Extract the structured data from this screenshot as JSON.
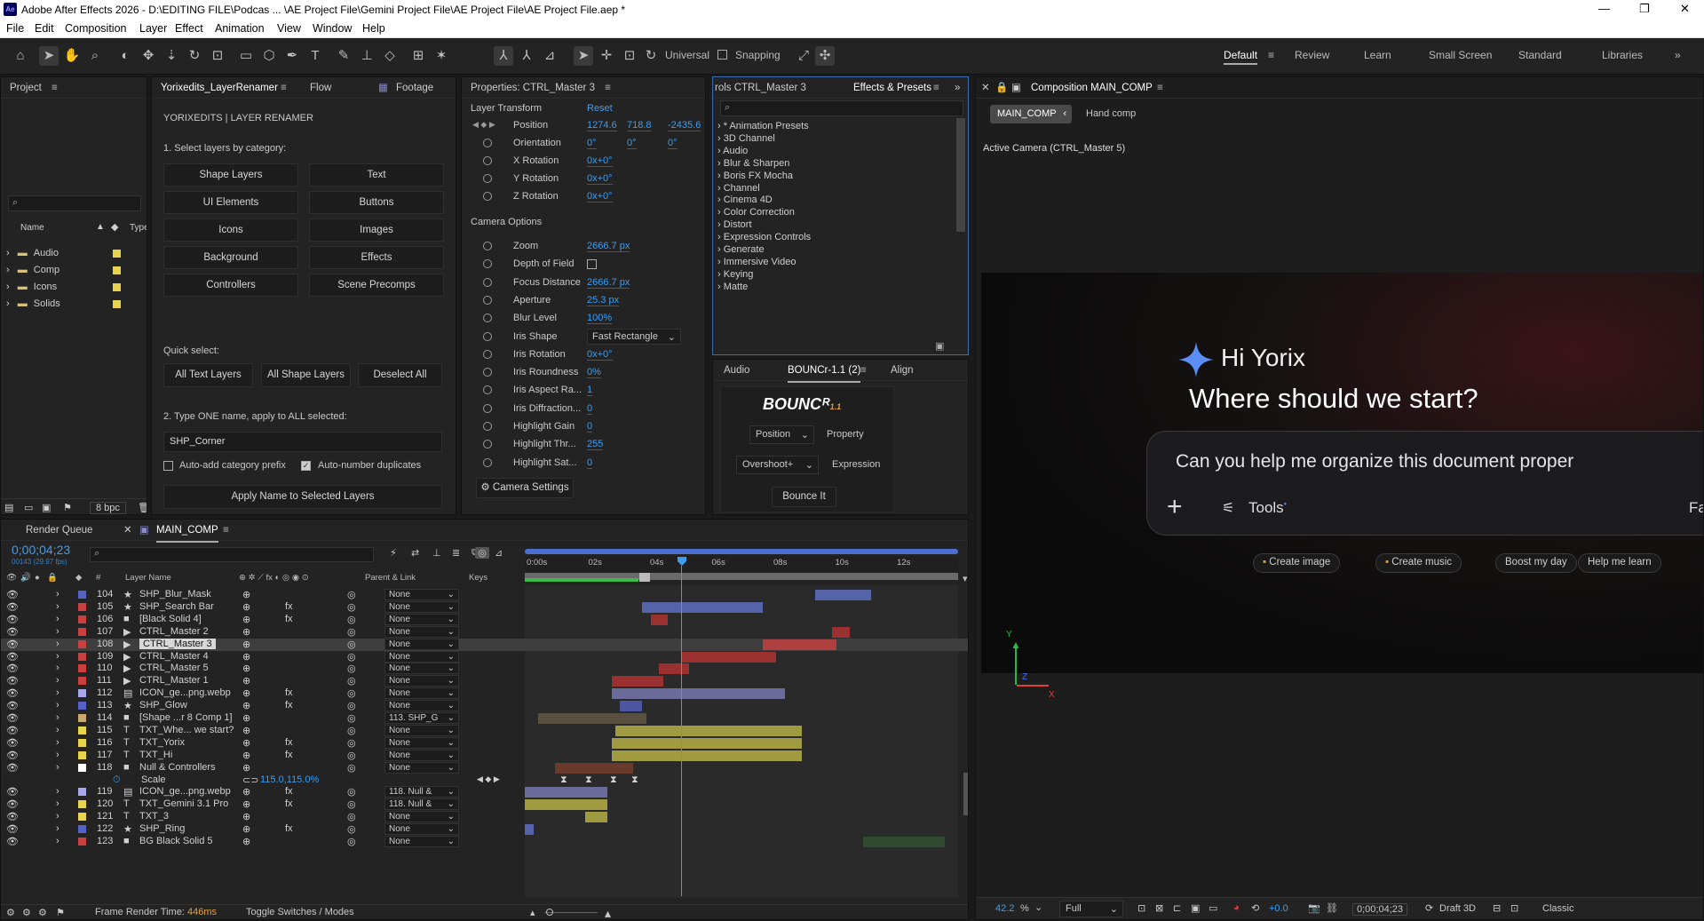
{
  "window": {
    "title": "Adobe After Effects 2026 - D:\\EDITING FILE\\Podcas ... \\AE Project File\\Gemini Project File\\AE Project File\\AE Project File.aep *",
    "app_badge": "Ae"
  },
  "menu": [
    "File",
    "Edit",
    "Composition",
    "Layer",
    "Effect",
    "Animation",
    "View",
    "Window",
    "Help"
  ],
  "toolbar": {
    "universal": "Universal",
    "snapping": "Snapping"
  },
  "workspaces": [
    "Default",
    "Review",
    "Learn",
    "Small Screen",
    "Standard",
    "Libraries"
  ],
  "project": {
    "tab": "Project",
    "col_name": "Name",
    "col_type": "Type",
    "items": [
      {
        "name": "Audio",
        "color": "#e8d44c"
      },
      {
        "name": "Comp",
        "color": "#e8d44c"
      },
      {
        "name": "Icons",
        "color": "#e8d44c"
      },
      {
        "name": "Solids",
        "color": "#e8d44c"
      }
    ],
    "bpc": "8 bpc"
  },
  "renamer": {
    "tabs": [
      "Yorixedits_LayerRenamer",
      "Flow",
      "Footage"
    ],
    "heading": "YORIXEDITS | LAYER RENAMER",
    "step1": "1. Select layers by category:",
    "categories": [
      "Shape Layers",
      "Text",
      "UI Elements",
      "Buttons",
      "Icons",
      "Images",
      "Background",
      "Effects",
      "Controllers",
      "Scene Precomps"
    ],
    "quick": "Quick select:",
    "quick_buttons": [
      "All Text Layers",
      "All Shape Layers",
      "Deselect All"
    ],
    "step2": "2. Type ONE name, apply to ALL selected:",
    "name_value": "SHP_Corner",
    "opt1": "Auto-add category prefix",
    "opt2": "Auto-number duplicates",
    "apply": "Apply Name to Selected Layers"
  },
  "props": {
    "tab": "Properties: CTRL_Master 3",
    "layer_transform": "Layer Transform",
    "reset": "Reset",
    "position_label": "Position",
    "position": [
      "1274.6",
      "718.8",
      "-2435.6"
    ],
    "orientation_label": "Orientation",
    "orientation": [
      "0°",
      "0°",
      "0°"
    ],
    "xrot_label": "X Rotation",
    "xrot": "0x+0°",
    "yrot_label": "Y Rotation",
    "yrot": "0x+0°",
    "zrot_label": "Z Rotation",
    "zrot": "0x+0°",
    "camera_options": "Camera Options",
    "cam_rows": [
      {
        "label": "Zoom",
        "value": "2666.7 px"
      },
      {
        "label": "Depth of Field",
        "value": ""
      },
      {
        "label": "Focus Distance",
        "value": "2666.7 px"
      },
      {
        "label": "Aperture",
        "value": "25.3 px"
      },
      {
        "label": "Blur Level",
        "value": "100%"
      },
      {
        "label": "Iris Shape",
        "value": "Fast Rectangle"
      },
      {
        "label": "Iris Rotation",
        "value": "0x+0°"
      },
      {
        "label": "Iris Roundness",
        "value": "0%"
      },
      {
        "label": "Iris Aspect Ra...",
        "value": "1"
      },
      {
        "label": "Iris Diffraction...",
        "value": "0"
      },
      {
        "label": "Highlight Gain",
        "value": "0"
      },
      {
        "label": "Highlight Thr...",
        "value": "255"
      },
      {
        "label": "Highlight Sat...",
        "value": "0"
      }
    ],
    "camera_settings": "Camera Settings"
  },
  "effects": {
    "tab_left": "rols CTRL_Master 3",
    "tab": "Effects & Presets",
    "items": [
      "* Animation Presets",
      "3D Channel",
      "Audio",
      "Blur & Sharpen",
      "Boris FX Mocha",
      "Channel",
      "Cinema 4D",
      "Color Correction",
      "Distort",
      "Expression Controls",
      "Generate",
      "Immersive Video",
      "Keying",
      "Matte"
    ]
  },
  "bounce": {
    "tabs": [
      "Audio",
      "BOUNCr-1.1 (2)",
      "Align"
    ],
    "logo": "BOUNCᴿ",
    "logo_ver": "1.1",
    "position": "Position",
    "property": "Property",
    "overshoot": "Overshoot+",
    "expression": "Expression",
    "bounce_it": "Bounce It"
  },
  "comp": {
    "tab": "Composition MAIN_COMP",
    "crumb1": "MAIN_COMP",
    "crumb2": "Hand comp",
    "camera": "Active Camera (CTRL_Master 5)",
    "greet": "Hi Yorix",
    "question": "Where should we start?",
    "prompt": "Can you help me organize this document proper",
    "tools": "Tools",
    "chips": [
      "Create image",
      "Create music",
      "Boost my day",
      "Help me learn"
    ],
    "zoom": "42.2",
    "zoom_unit": "%",
    "res": "Full",
    "exposure": "+0.0",
    "timecode": "0;00;04;23",
    "renderer": "Draft 3D",
    "classic": "Classic",
    "axes": {
      "y": "Y",
      "z": "Z",
      "x": "X"
    }
  },
  "timeline": {
    "tabs": [
      "Render Queue",
      "MAIN_COMP"
    ],
    "timecode": "0;00;04;23",
    "sub": "00143 (29.97 fps)",
    "col_layer": "Layer Name",
    "col_parent": "Parent & Link",
    "col_keys": "Keys",
    "ruler": [
      "0:00s",
      "02s",
      "04s",
      "06s",
      "08s",
      "10s",
      "12s"
    ],
    "layers": [
      {
        "num": "104",
        "name": "SHP_Blur_Mask",
        "color": "#5563c4",
        "parent": "None",
        "bar": [
          0.67,
          0.8
        ],
        "barc": "#5563a8"
      },
      {
        "num": "105",
        "name": "SHP_Search Bar",
        "color": "#c84040",
        "parent": "None",
        "bar": [
          0.27,
          0.55
        ],
        "barc": "#5563a8"
      },
      {
        "num": "106",
        "name": "[Black Solid 4]",
        "color": "#c84040",
        "parent": "None",
        "bar": [
          0.29,
          0.33
        ],
        "barc": "#9b3030"
      },
      {
        "num": "107",
        "name": "CTRL_Master 2",
        "color": "#c84040",
        "parent": "None",
        "bar": [
          0.71,
          0.75
        ],
        "barc": "#9b3030"
      },
      {
        "num": "108",
        "name": "CTRL_Master 3",
        "color": "#c84040",
        "parent": "None",
        "bar": [
          0.55,
          0.72
        ],
        "barc": "#b04040",
        "sel": true
      },
      {
        "num": "109",
        "name": "CTRL_Master 4",
        "color": "#c84040",
        "parent": "None",
        "bar": [
          0.36,
          0.58
        ],
        "barc": "#9b3030"
      },
      {
        "num": "110",
        "name": "CTRL_Master 5",
        "color": "#c84040",
        "parent": "None",
        "bar": [
          0.31,
          0.38
        ],
        "barc": "#9b3030"
      },
      {
        "num": "111",
        "name": "CTRL_Master 1",
        "color": "#c84040",
        "parent": "None",
        "bar": [
          0.2,
          0.32
        ],
        "barc": "#9b3030"
      },
      {
        "num": "112",
        "name": "ICON_ge...png.webp",
        "color": "#a8a8e8",
        "parent": "None",
        "bar": [
          0.2,
          0.6
        ],
        "barc": "#6b6b9b"
      },
      {
        "num": "113",
        "name": "SHP_Glow",
        "color": "#5563c4",
        "parent": "None",
        "bar": [
          0.22,
          0.27
        ],
        "barc": "#4a56a0"
      },
      {
        "num": "114",
        "name": "[Shape ...r 8 Comp 1]",
        "color": "#c8a870",
        "parent": "113. SHP_G",
        "bar": [
          0.03,
          0.28
        ],
        "barc": "#5a5040"
      },
      {
        "num": "115",
        "name": "TXT_Whe... we start?",
        "color": "#e8d44c",
        "parent": "None",
        "bar": [
          0.21,
          0.64
        ],
        "barc": "#a09a40"
      },
      {
        "num": "116",
        "name": "TXT_Yorix",
        "color": "#e8d44c",
        "parent": "None",
        "bar": [
          0.2,
          0.64
        ],
        "barc": "#a09a40"
      },
      {
        "num": "117",
        "name": "TXT_Hi",
        "color": "#e8d44c",
        "parent": "None",
        "bar": [
          0.2,
          0.64
        ],
        "barc": "#a09a40"
      },
      {
        "num": "118",
        "name": "Null & Controllers",
        "color": "#ffffff",
        "parent": "None",
        "bar": [
          0.07,
          0.25
        ],
        "barc": "#6a3a2a"
      }
    ],
    "scale_label": "Scale",
    "scale_value": "115.0,115.0%",
    "layers2": [
      {
        "num": "119",
        "name": "ICON_ge...png.webp",
        "color": "#a8a8e8",
        "parent": "118. Null &",
        "bar": [
          0.0,
          0.19
        ],
        "barc": "#6b6b9b"
      },
      {
        "num": "120",
        "name": "TXT_Gemini 3.1 Pro",
        "color": "#e8d44c",
        "parent": "118. Null &",
        "bar": [
          0.0,
          0.19
        ],
        "barc": "#a09a40"
      },
      {
        "num": "121",
        "name": "TXT_3",
        "color": "#e8d44c",
        "parent": "None",
        "bar": [
          0.14,
          0.19
        ],
        "barc": "#a09a40"
      },
      {
        "num": "122",
        "name": "SHP_Ring",
        "color": "#5563c4",
        "parent": "None",
        "bar": [
          0.0,
          0.02
        ],
        "barc": "#5563a8"
      },
      {
        "num": "123",
        "name": "BG Black Solid 5",
        "color": "#c84040",
        "parent": "None",
        "bar": [
          0.78,
          0.97
        ],
        "barc": "#2f4a2f"
      }
    ],
    "frame_render": "Frame Render Time:",
    "frame_ms": "446ms",
    "toggle": "Toggle Switches / Modes"
  }
}
